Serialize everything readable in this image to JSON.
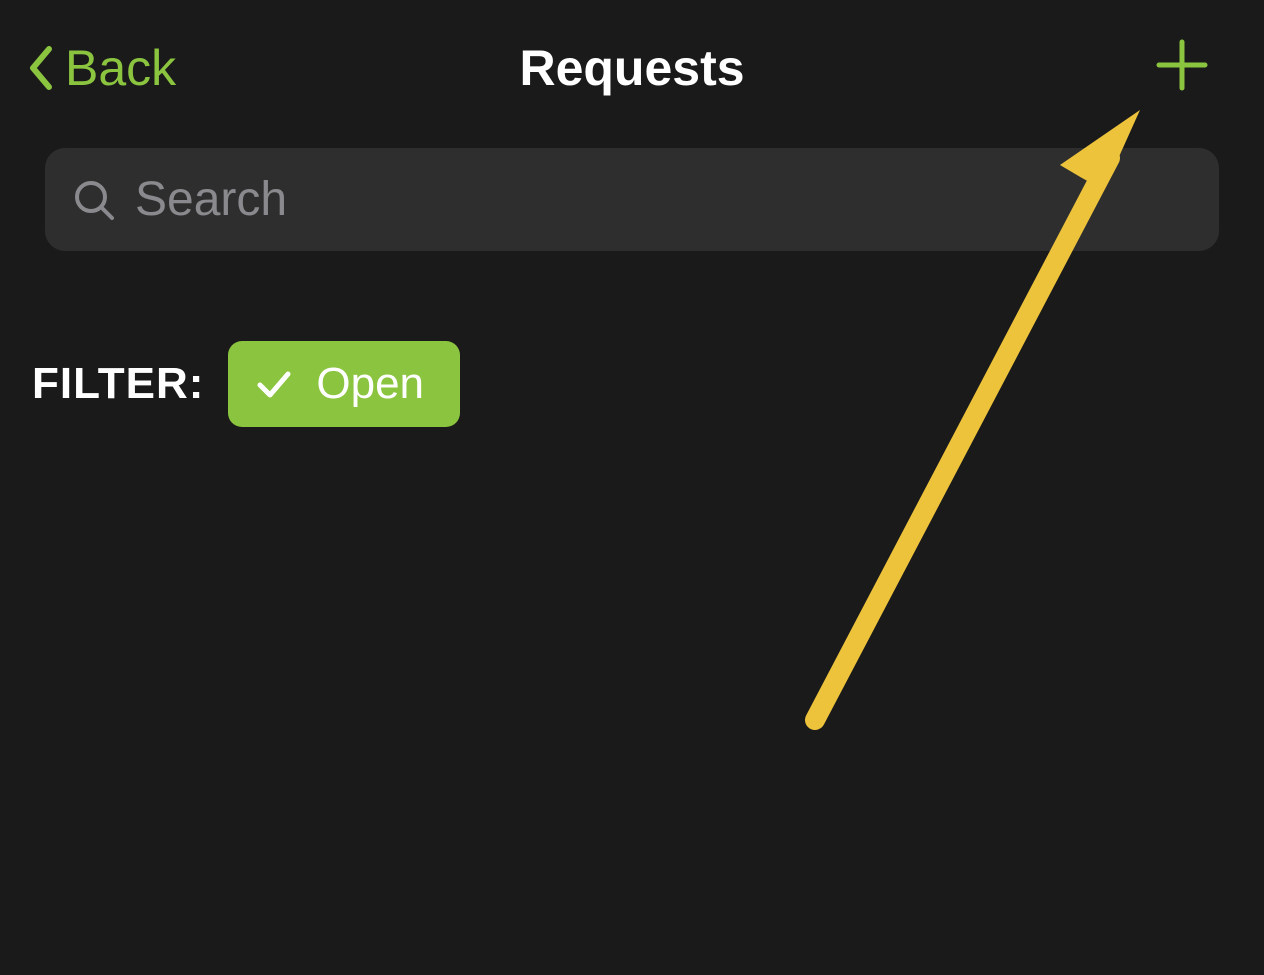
{
  "header": {
    "back_label": "Back",
    "title": "Requests"
  },
  "search": {
    "placeholder": "Search",
    "value": ""
  },
  "filter": {
    "label": "FILTER:",
    "chip_label": "Open"
  },
  "colors": {
    "accent": "#8bc43f",
    "arrow": "#eec33c",
    "background": "#1a1a1a",
    "search_bg": "#2e2e2e",
    "placeholder": "#8a8a8e"
  }
}
